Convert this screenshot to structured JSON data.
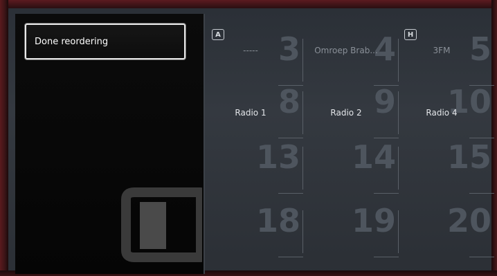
{
  "menu": {
    "items": [
      {
        "label": "Done reordering"
      }
    ]
  },
  "grid": {
    "tags": [
      "A",
      "H"
    ],
    "channels": [
      {
        "number": "3",
        "name": "-----"
      },
      {
        "number": "4",
        "name": "Omroep Brab..."
      },
      {
        "number": "5",
        "name": "3FM"
      },
      {
        "number": "8",
        "name": "Radio 1"
      },
      {
        "number": "9",
        "name": "Radio 2"
      },
      {
        "number": "10",
        "name": "Radio 4"
      },
      {
        "number": "13",
        "name": ""
      },
      {
        "number": "14",
        "name": ""
      },
      {
        "number": "15",
        "name": ""
      },
      {
        "number": "18",
        "name": ""
      },
      {
        "number": "19",
        "name": ""
      },
      {
        "number": "20",
        "name": ""
      }
    ]
  },
  "colors": {
    "panel_bg": "#0a0a0a",
    "grid_bg": "#30353c",
    "highlight_border": "#e8e8e8",
    "number_color": "#4e555e"
  }
}
